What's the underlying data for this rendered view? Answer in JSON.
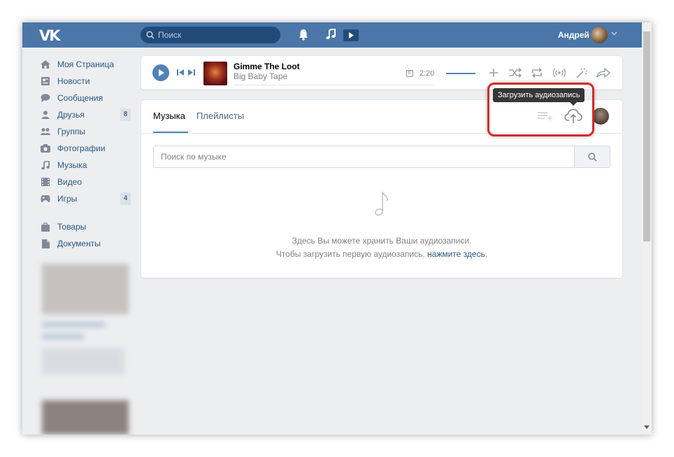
{
  "header": {
    "search_placeholder": "Поиск",
    "user_name": "Андрей"
  },
  "sidebar": {
    "items": [
      {
        "label": "Моя Страница",
        "icon": "home-icon"
      },
      {
        "label": "Новости",
        "icon": "news-icon"
      },
      {
        "label": "Сообщения",
        "icon": "messages-icon"
      },
      {
        "label": "Друзья",
        "icon": "friends-icon",
        "count": "8"
      },
      {
        "label": "Группы",
        "icon": "groups-icon"
      },
      {
        "label": "Фотографии",
        "icon": "photos-icon"
      },
      {
        "label": "Музыка",
        "icon": "music-icon"
      },
      {
        "label": "Видео",
        "icon": "video-icon"
      },
      {
        "label": "Игры",
        "icon": "games-icon",
        "count": "4"
      }
    ],
    "extra_items": [
      {
        "label": "Товары",
        "icon": "market-icon"
      },
      {
        "label": "Документы",
        "icon": "documents-icon"
      }
    ]
  },
  "player": {
    "track_title": "Gimme The Loot",
    "track_artist": "Big Baby Tape",
    "explicit_mark": "E",
    "duration": "2:20"
  },
  "music": {
    "tabs": [
      "Музыка",
      "Плейлисты"
    ],
    "upload_tooltip": "Загрузить аудиозапись",
    "search_placeholder": "Поиск по музыке",
    "empty_line1": "Здесь Вы можете хранить Ваши аудиозаписи.",
    "empty_line2_prefix": "Чтобы загрузить первую аудиозапись, ",
    "empty_line2_link": "нажмите здесь",
    "empty_line2_suffix": "."
  },
  "colors": {
    "header": "#4a76a8",
    "accent": "#5181b8",
    "link": "#2a5885",
    "highlight": "#d52a2a"
  }
}
